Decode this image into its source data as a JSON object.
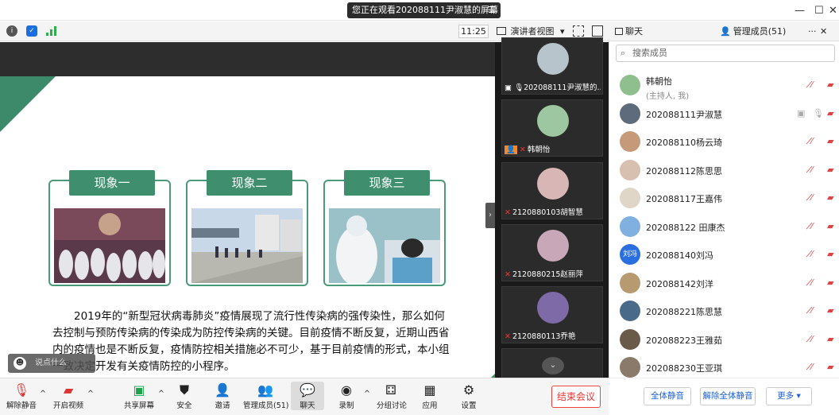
{
  "banner": {
    "text": "您正在观看202088111尹淑慧的屏幕"
  },
  "window": {
    "minimize": "—",
    "maximize": "☐",
    "close": "✕"
  },
  "bar2": {
    "time": "11:25",
    "view_label": "演讲者视图",
    "view_caret": "▾"
  },
  "slide": {
    "phenomena": [
      "现象一",
      "现象二",
      "现象三"
    ],
    "paragraph": "2019年的“新型冠状病毒肺炎”疫情展现了流行性传染病的强传染性，那么如何去控制与预防传染病的传染成为防控传染病的关键。目前疫情不断反复，近期山西省内的疫情也是不断反复，疫情防控相关措施必不可少，基于目前疫情的形式，本小组一致决定开发有关疫情防控的小程序。",
    "speech_placeholder": "说点什么"
  },
  "gallery": {
    "tiles": [
      {
        "name": "202088111尹淑慧的...",
        "color": "#b8c4cc"
      },
      {
        "name": "韩朝怡",
        "color": "#9cc7a0"
      },
      {
        "name": "2120880103胡智慧",
        "color": "#d8b6b6"
      },
      {
        "name": "2120880215赵丽萍",
        "color": "#c8a8b8"
      },
      {
        "name": "2120880113乔艳",
        "color": "#7f6aa8"
      }
    ]
  },
  "panel": {
    "chat_tab": "聊天",
    "members_tab": "管理成员(51)",
    "more": "···",
    "close": "✕",
    "search_placeholder": "搜索成员",
    "members": [
      {
        "name": "韩朝怡",
        "sub": "(主持人, 我)",
        "color": "#8fbf8f",
        "initials": ""
      },
      {
        "name": "202088111尹淑慧",
        "sub": "",
        "color": "#5d6b7a",
        "initials": ""
      },
      {
        "name": "202088110杨云琦",
        "sub": "",
        "color": "#c49a7a",
        "initials": ""
      },
      {
        "name": "202088112陈思思",
        "sub": "",
        "color": "#d8c0b0",
        "initials": ""
      },
      {
        "name": "202088117王嘉伟",
        "sub": "",
        "color": "#e0d6c8",
        "initials": ""
      },
      {
        "name": "202088122 田康杰",
        "sub": "",
        "color": "#7fb0e0",
        "initials": ""
      },
      {
        "name": "202088140刘冯",
        "sub": "",
        "color": "#2a6fe0",
        "initials": "刘冯"
      },
      {
        "name": "202088142刘洋",
        "sub": "",
        "color": "#b89a70",
        "initials": ""
      },
      {
        "name": "202088221陈思慧",
        "sub": "",
        "color": "#4a6a8a",
        "initials": ""
      },
      {
        "name": "202088223王雅茹",
        "sub": "",
        "color": "#6a5a4a",
        "initials": ""
      },
      {
        "name": "202088230王亚琪",
        "sub": "",
        "color": "#8a7a6a",
        "initials": ""
      }
    ],
    "mute_all": "全体静音",
    "unmute_all": "解除全体静音",
    "more_btn": "更多 ▾"
  },
  "toolbar": {
    "unmute": "解除静音",
    "start_video": "开启视频",
    "share": "共享屏幕",
    "security": "安全",
    "invite": "邀请",
    "manage": "管理成员(51)",
    "chat": "聊天",
    "record": "录制",
    "breakout": "分组讨论",
    "apps": "应用",
    "settings": "设置",
    "end": "结束会议"
  }
}
